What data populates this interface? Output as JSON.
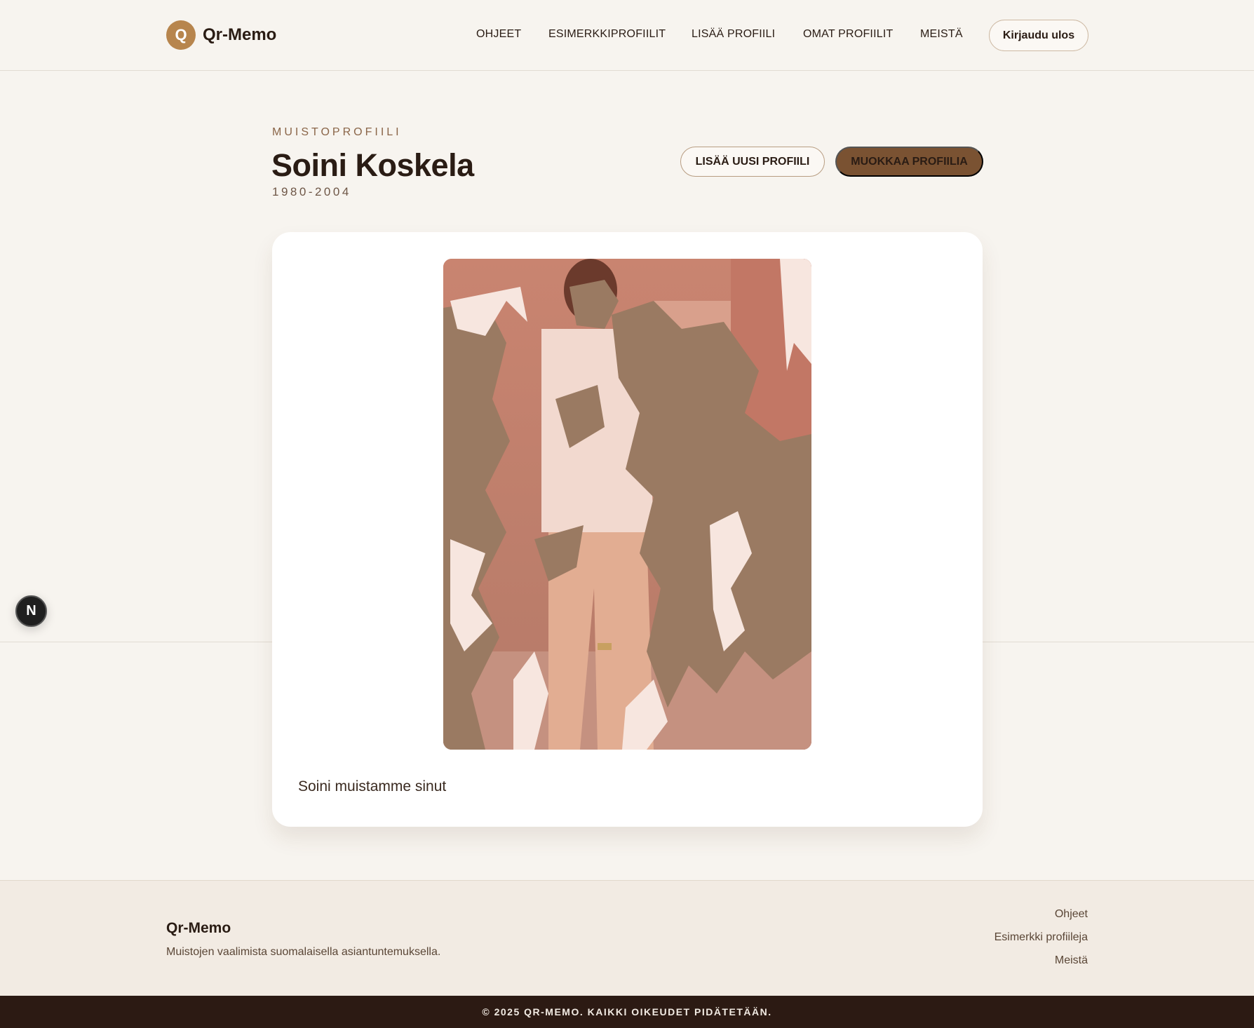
{
  "header": {
    "logo_letter": "Q",
    "logo_text": "Qr-Memo",
    "nav": [
      {
        "label": "OHJEET"
      },
      {
        "label": "ESIMERKKIPROFIILIT"
      },
      {
        "label": "LISÄÄ PROFIILI"
      },
      {
        "label": "OMAT PROFIILIT"
      },
      {
        "label": "MEISTÄ"
      }
    ],
    "logout_label": "Kirjaudu ulos"
  },
  "profile": {
    "eyebrow": "MUISTOPROFIILI",
    "name": "Soini Koskela",
    "years": "1980-2004",
    "add_new_label": "LISÄÄ UUSI PROFIILI",
    "edit_label": "MUOKKAA PROFIILIA",
    "message": "Soini muistamme sinut"
  },
  "floating": {
    "label": "N"
  },
  "footer": {
    "brand": "Qr-Memo",
    "tagline": "Muistojen vaalimista suomalaisella asiantuntemuksella.",
    "links": [
      {
        "label": "Ohjeet"
      },
      {
        "label": "Esimerkki profiileja"
      },
      {
        "label": "Meistä"
      }
    ],
    "copyright": "© 2025 QR-MEMO. KAIKKI OIKEUDET PIDÄTETÄÄN."
  },
  "colors": {
    "background": "#f7f4ef",
    "accent": "#b7854d",
    "primary_button": "#7a5232",
    "footer_bar": "#2c1a13"
  }
}
